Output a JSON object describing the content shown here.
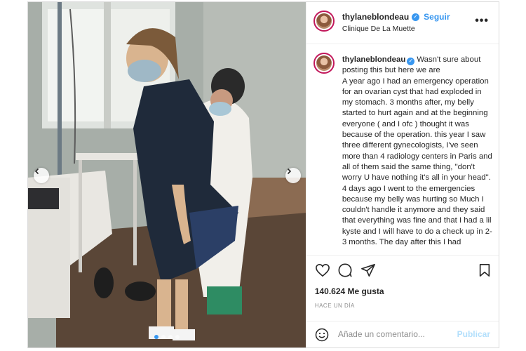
{
  "post": {
    "author": {
      "username": "thylaneblondeau",
      "follow_label": "Seguir",
      "location": "Clinique De La Muette"
    },
    "caption": {
      "username": "thylaneblondeau",
      "paragraphs": [
        "Wasn't sure about posting this but here we are",
        "A year ago I had an emergency operation for an ovarian cyst that had exploded in my stomach. 3 months after, my belly started to hurt again and at the beginning everyone ( and I ofc ) thought it was because of the operation. this year I saw three different gynecologists, I've seen more than 4 radiology centers in Paris and all of them said the same thing, \"don't worry U have nothing it's all in your head\".",
        "4 days ago I went to the emergencies because my belly was hurting so Much I couldn't handle it anymore and they said that everything was fine and that I had a lil kyste and I will have to do a check up in 2-3 months. The day after this I had"
      ]
    },
    "likes": "140.624 Me gusta",
    "timestamp": "HACE UN DÍA",
    "comment_placeholder": "Añade un comentario...",
    "publish_label": "Publicar",
    "carousel": {
      "slides": 4,
      "active_index": 0
    },
    "icons": [
      "chevron-left-icon",
      "chevron-right-icon",
      "heart-icon",
      "comment-icon",
      "share-icon",
      "bookmark-icon",
      "emoji-icon",
      "more-options-icon",
      "verified-icon"
    ],
    "colors": {
      "link_blue": "#3897f0",
      "publish_disabled": "#b2dffc",
      "story_ring": "#c2185b"
    }
  }
}
